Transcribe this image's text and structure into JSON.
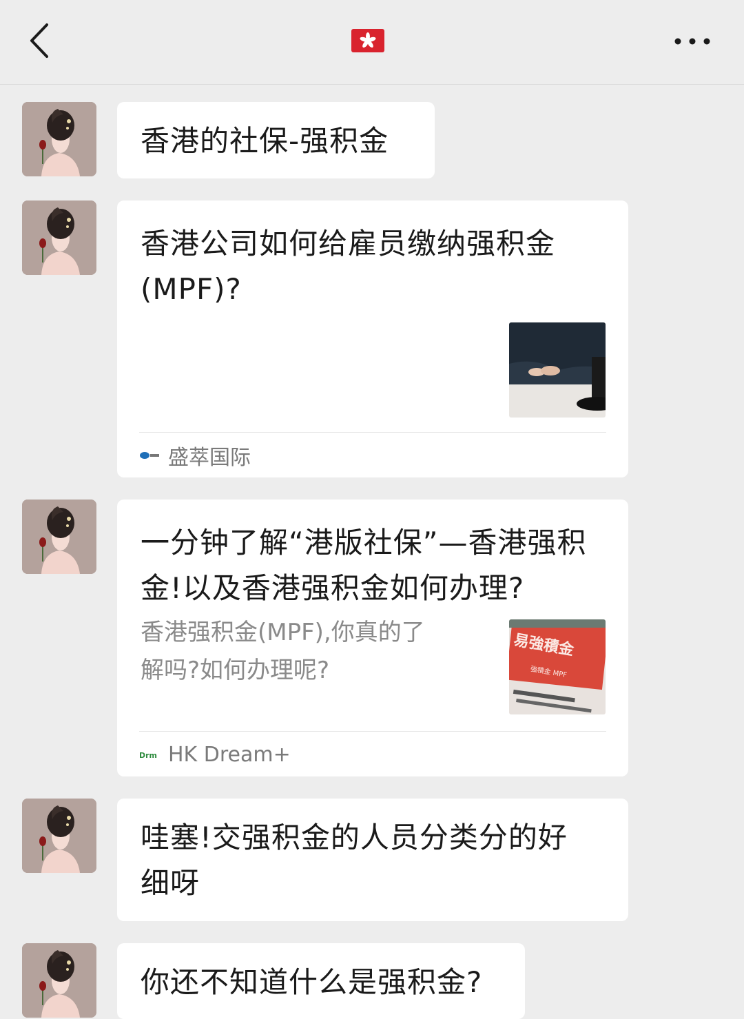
{
  "header": {
    "back_icon": "chevron-left-icon",
    "title_icon": "hong-kong-flag-icon",
    "more_icon": "more-dots-icon"
  },
  "messages": [
    {
      "type": "text",
      "text": "香港的社保-强积金"
    },
    {
      "type": "link",
      "title_line1": "香港公司如何给雇员缴纳强积金",
      "title_line2": "(MPF)?",
      "source": "盛萃国际"
    },
    {
      "type": "link",
      "title_line1": "一分钟了解“港版社保”—香港强积",
      "title_line2": "金!以及香港强积金如何办理?",
      "desc_line1": "香港强积金(MPF),你真的了",
      "desc_line2": "解吗?如何办理呢?",
      "thumb_text1": "易強積金",
      "thumb_text2": "強積金 MPF",
      "source": "HK Dream+"
    },
    {
      "type": "text",
      "line1": "哇塞!交强积金的人员分类分的好",
      "line2": "细呀"
    },
    {
      "type": "text",
      "text": "你还不知道什么是强积金?"
    }
  ],
  "colors": {
    "background": "#ededed",
    "bubble": "#ffffff",
    "flag_red": "#d9232e",
    "secondary_text": "#8a8a8a"
  }
}
